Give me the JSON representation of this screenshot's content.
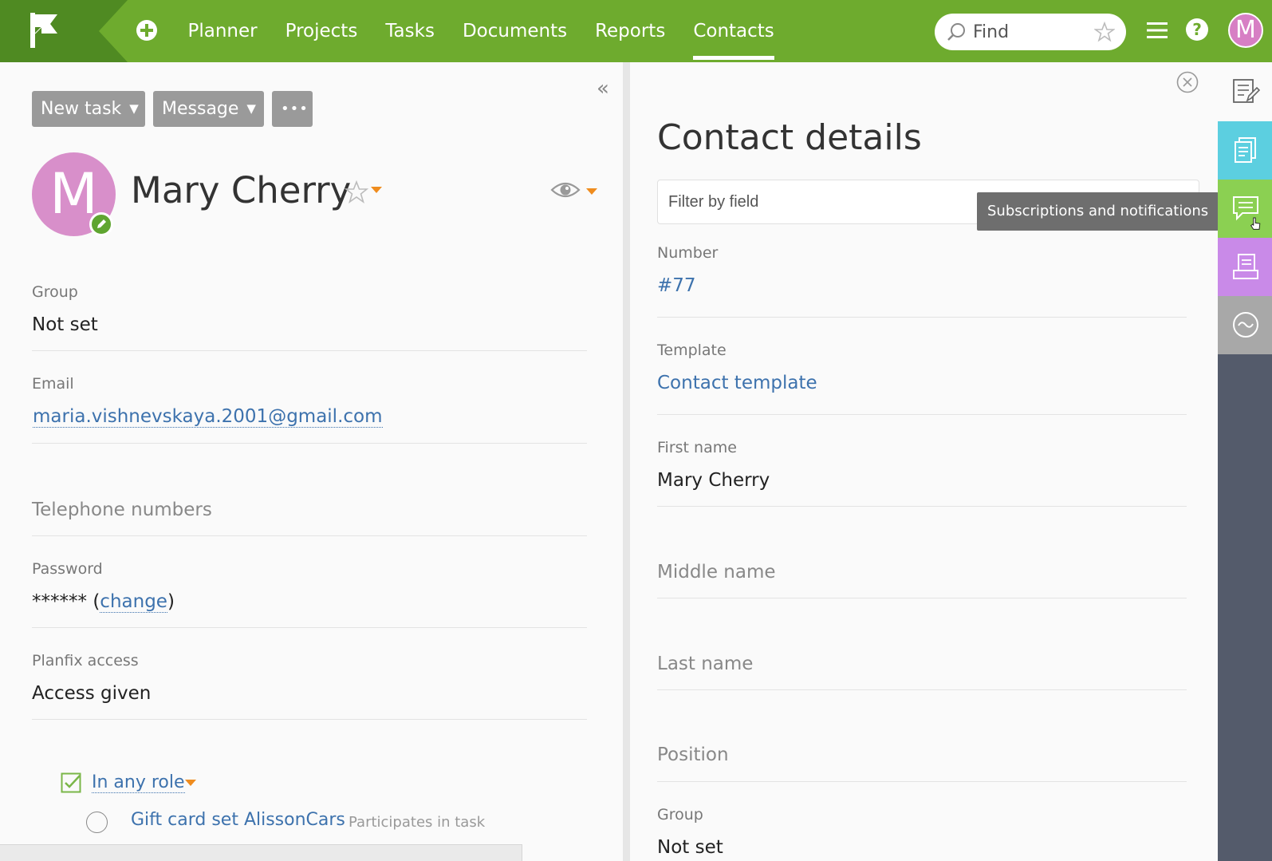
{
  "colors": {
    "topbar": "#6eab2e",
    "accent_orange": "#ef8c1e",
    "link": "#3d72ad",
    "avatar": "#d88fca",
    "rail_documents": "#5ccfe0",
    "rail_comments": "#8bd052",
    "rail_print": "#c98ae8",
    "rail_activity": "#a8a8a8",
    "rail_bg": "#545b6b"
  },
  "topbar": {
    "nav": [
      "Planner",
      "Projects",
      "Tasks",
      "Documents",
      "Reports",
      "Contacts"
    ],
    "active_nav": "Contacts",
    "search_placeholder": "Find",
    "user_initial": "M"
  },
  "left": {
    "buttons": {
      "new_task": "New task",
      "message": "Message",
      "more": "•••"
    },
    "avatar_initial": "M",
    "name": "Mary Cherry",
    "fields": {
      "group_label": "Group",
      "group_value": "Not set",
      "email_label": "Email",
      "email_value": "maria.vishnevskaya.2001@gmail.com",
      "telephone_label": "Telephone numbers",
      "password_label": "Password",
      "password_mask": "******",
      "password_open": "(",
      "password_change": "change",
      "password_close": ")",
      "access_label": "Planfix access",
      "access_value": "Access given"
    },
    "role_filter": "In any role",
    "tasks": [
      {
        "title": "Gift card set AlissonCars",
        "note": "Participates in task"
      }
    ]
  },
  "right": {
    "title": "Contact details",
    "filter_placeholder": "Filter by field",
    "tooltip": "Subscriptions and notifications",
    "fields": {
      "number_label": "Number",
      "number_value": "#77",
      "template_label": "Template",
      "template_value": "Contact template",
      "first_name_label": "First name",
      "first_name_value": "Mary Cherry",
      "middle_name_label": "Middle name",
      "last_name_label": "Last name",
      "position_label": "Position",
      "group_label": "Group",
      "group_value": "Not set"
    }
  },
  "rail": {
    "icons": [
      "edit-notes-icon",
      "documents-icon",
      "comments-icon",
      "print-icon",
      "activity-icon"
    ]
  }
}
